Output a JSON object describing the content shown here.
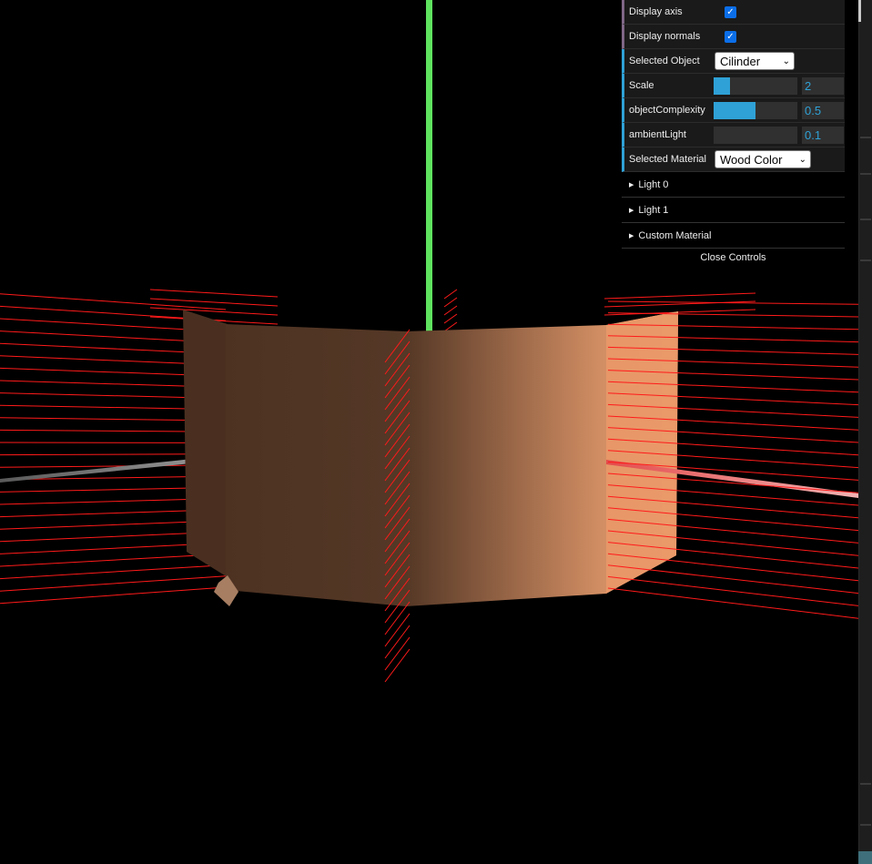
{
  "gui": {
    "display_axis": {
      "label": "Display axis",
      "checked": true
    },
    "display_normals": {
      "label": "Display normals",
      "checked": true
    },
    "selected_object": {
      "label": "Selected Object",
      "value": "Cilinder"
    },
    "scale": {
      "label": "Scale",
      "value": "2",
      "fraction": 0.2
    },
    "object_complexity": {
      "label": "objectComplexity",
      "value": "0.5",
      "fraction": 0.5
    },
    "ambient_light": {
      "label": "ambientLight",
      "value": "0.1",
      "fraction": 0.0
    },
    "selected_material": {
      "label": "Selected Material",
      "value": "Wood Color"
    },
    "folders": [
      {
        "label": "Light 0"
      },
      {
        "label": "Light 1"
      },
      {
        "label": "Custom Material"
      }
    ],
    "close_label": "Close Controls"
  },
  "colors": {
    "accent": "#2fa1d6",
    "bool_accent": "#806787",
    "checkbox": "#0b6ee8",
    "axis_y": "#5fe35f",
    "axis_x": "#e46060",
    "axis_z": "#8a8a8a",
    "normals": "#ff1a1a"
  },
  "icons": {
    "checkbox": "checkmark-icon",
    "dropdown": "chevron-down-icon",
    "folder": "triangle-right-icon"
  }
}
